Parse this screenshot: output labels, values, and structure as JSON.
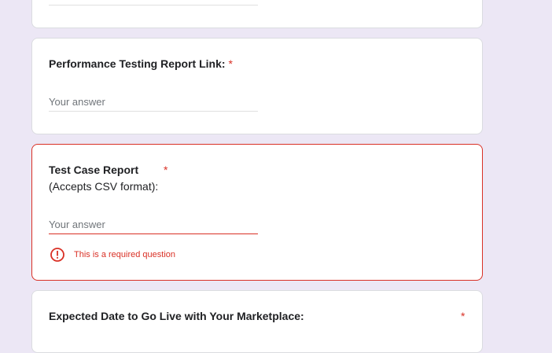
{
  "questions": [
    {
      "title": "",
      "placeholder": ""
    },
    {
      "title": "Performance Testing Report Link:",
      "required_mark": "*",
      "placeholder": "Your answer"
    },
    {
      "title": "Test Case Report",
      "subtitle": "(Accepts CSV format):",
      "required_mark": "*",
      "placeholder": "Your answer",
      "error": "This is a required question",
      "error_color": "#d93025"
    },
    {
      "title": "Expected Date to Go Live with Your Marketplace:",
      "required_mark": "*"
    }
  ],
  "colors": {
    "background": "#ece7f5",
    "card": "#ffffff",
    "error": "#d93025",
    "placeholder": "#70757a"
  }
}
